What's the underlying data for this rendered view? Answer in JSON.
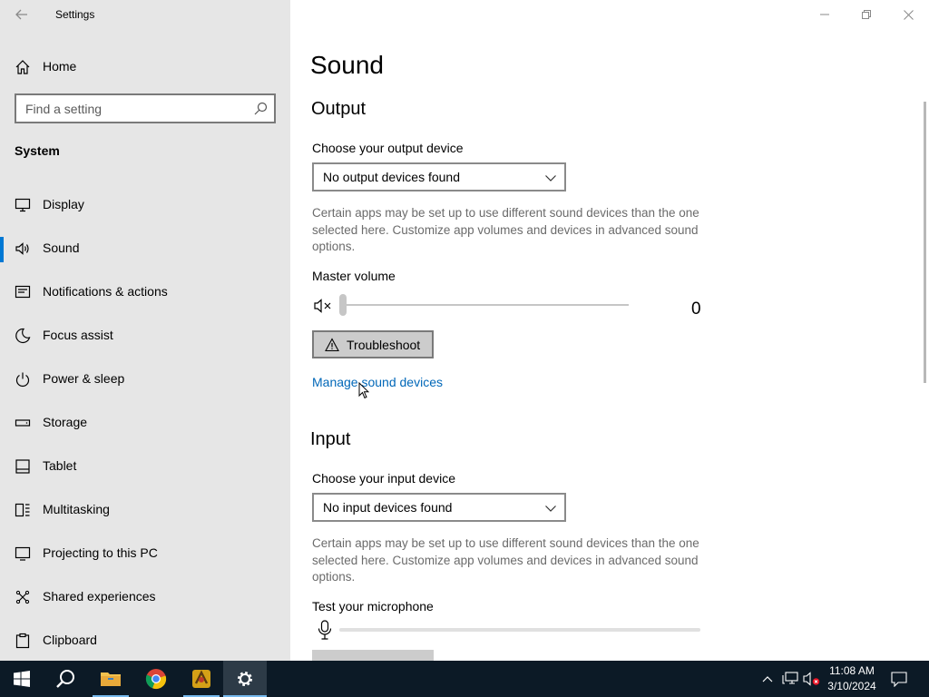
{
  "window": {
    "title": "Settings",
    "controls": {
      "minimize": "minimize-icon",
      "maximize": "restore-icon",
      "close": "close-icon"
    }
  },
  "sidebar": {
    "home_label": "Home",
    "search_placeholder": "Find a setting",
    "section_header": "System",
    "items": [
      {
        "label": "Display",
        "icon": "display-icon"
      },
      {
        "label": "Sound",
        "icon": "speaker-icon",
        "active": true
      },
      {
        "label": "Notifications & actions",
        "icon": "notification-icon"
      },
      {
        "label": "Focus assist",
        "icon": "moon-icon"
      },
      {
        "label": "Power & sleep",
        "icon": "power-icon"
      },
      {
        "label": "Storage",
        "icon": "storage-icon"
      },
      {
        "label": "Tablet",
        "icon": "tablet-icon"
      },
      {
        "label": "Multitasking",
        "icon": "multitasking-icon"
      },
      {
        "label": "Projecting to this PC",
        "icon": "projecting-icon"
      },
      {
        "label": "Shared experiences",
        "icon": "shared-icon"
      },
      {
        "label": "Clipboard",
        "icon": "clipboard-icon"
      }
    ]
  },
  "main": {
    "title": "Sound",
    "output": {
      "heading": "Output",
      "device_label": "Choose your output device",
      "device_value": "No output devices found",
      "description": "Certain apps may be set up to use different sound devices than the one selected here. Customize app volumes and devices in advanced sound options.",
      "volume_label": "Master volume",
      "volume_value": "0",
      "volume_level": 0,
      "troubleshoot_label": "Troubleshoot",
      "manage_link": "Manage sound devices"
    },
    "input": {
      "heading": "Input",
      "device_label": "Choose your input device",
      "device_value": "No input devices found",
      "description": "Certain apps may be set up to use different sound devices than the one selected here. Customize app volumes and devices in advanced sound options.",
      "test_label": "Test your microphone",
      "mic_level": 0
    }
  },
  "taskbar": {
    "apps": [
      "start-icon",
      "search-icon",
      "file-explorer-icon",
      "chrome-icon",
      "app-icon",
      "settings-icon"
    ],
    "clock_time": "11:08 AM",
    "clock_date": "3/10/2024"
  },
  "colors": {
    "accent": "#0078d4",
    "link": "#0067b8",
    "sidebar_bg": "#e6e6e6",
    "taskbar_bg": "#0c1a26"
  }
}
